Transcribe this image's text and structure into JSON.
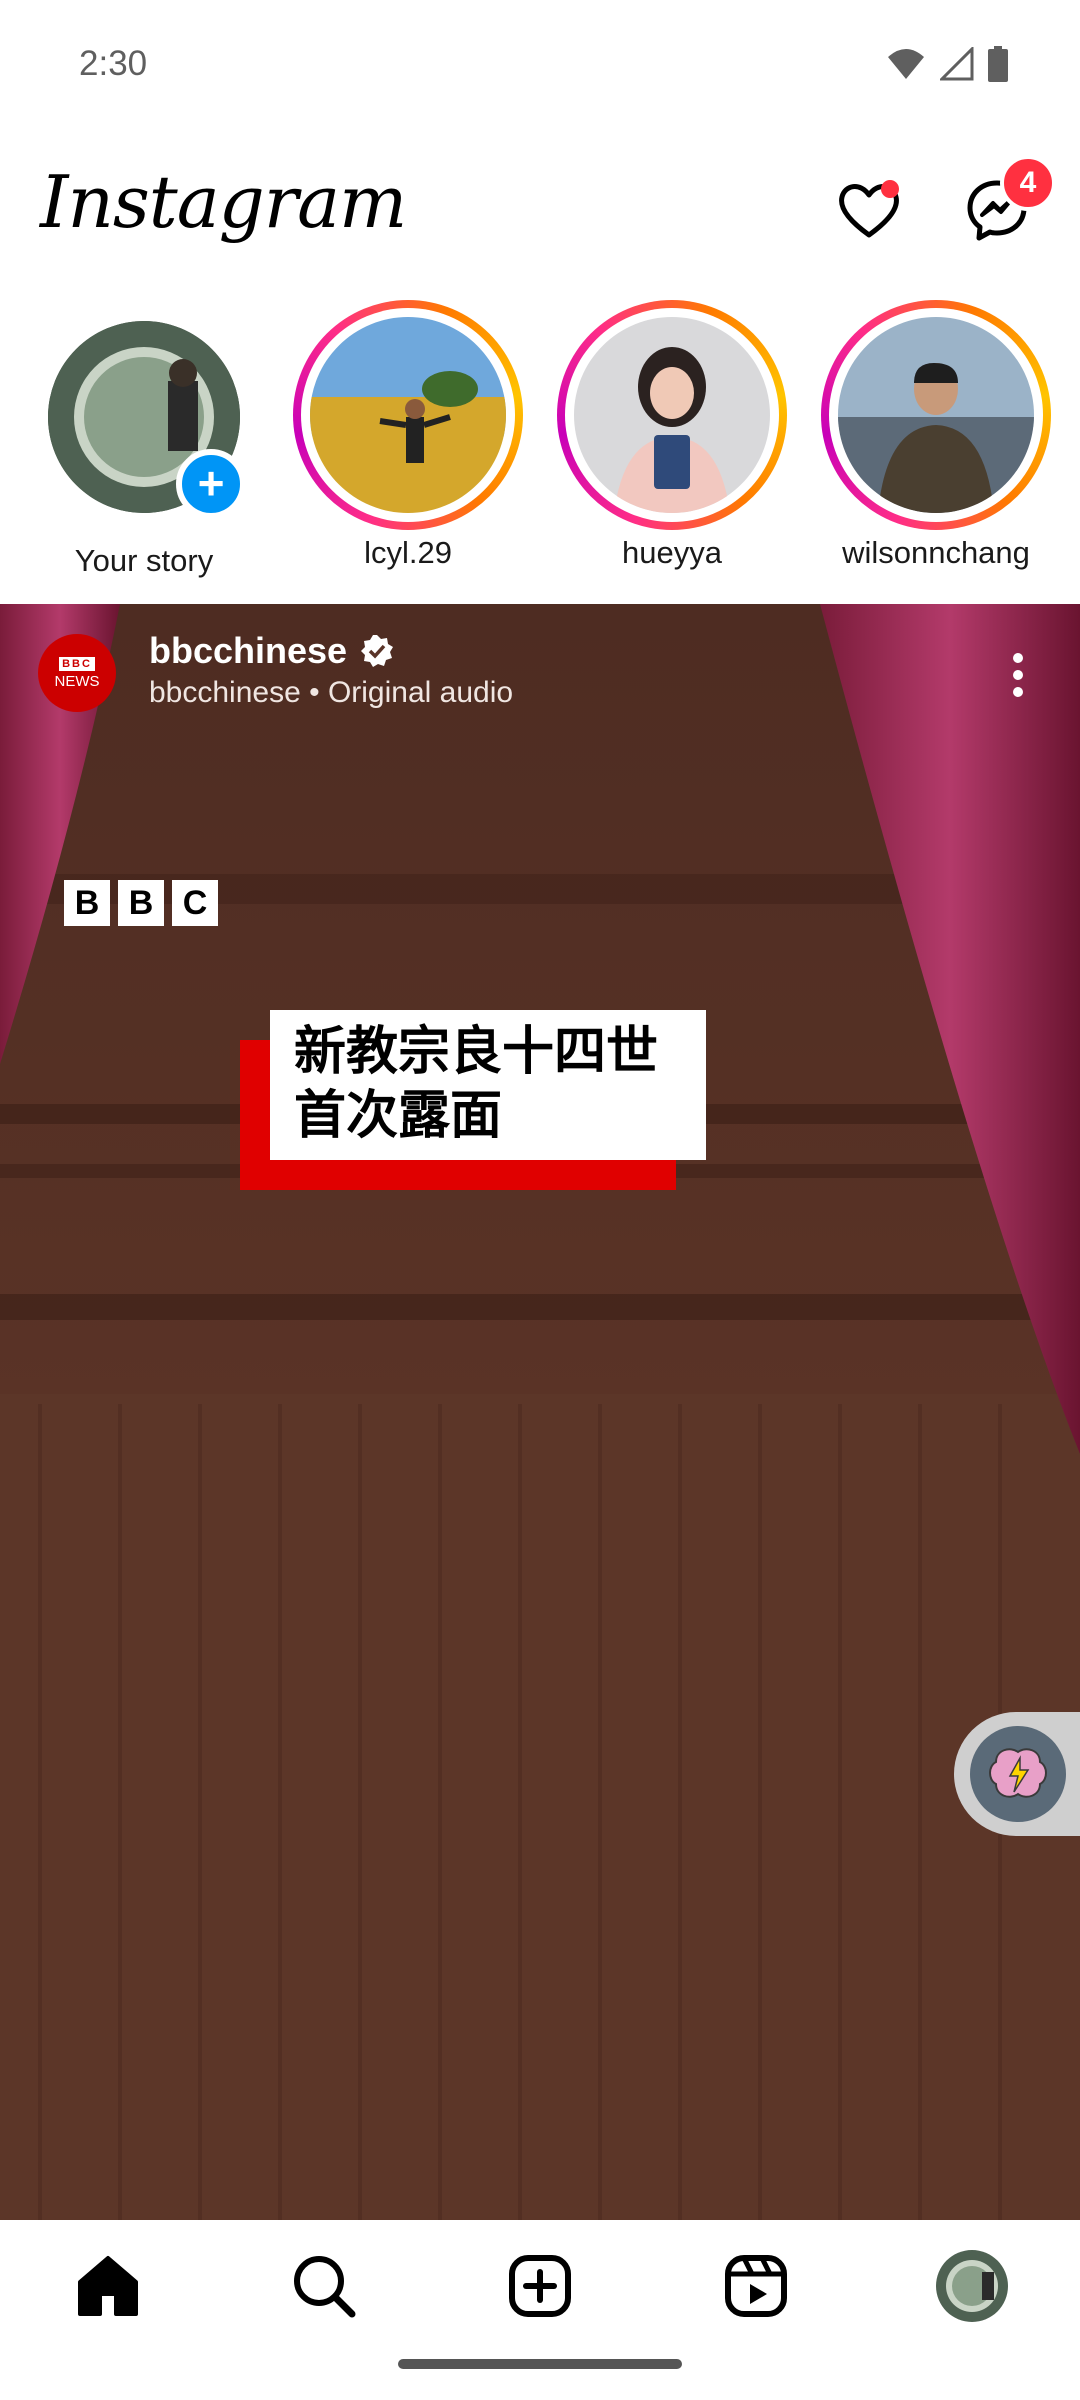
{
  "status_bar": {
    "time": "2:30"
  },
  "header": {
    "logo_text": "Instagram",
    "messages_badge": "4"
  },
  "stories": [
    {
      "name": "Your story",
      "is_own": true
    },
    {
      "name": "lcyl.29"
    },
    {
      "name": "hueyya"
    },
    {
      "name": "wilsonnchang"
    }
  ],
  "post": {
    "username": "bbcchinese",
    "subtitle": "bbcchinese • Original audio",
    "avatar_text_top": "BBC",
    "avatar_text_bottom": "NEWS",
    "bbc_letters": [
      "B",
      "B",
      "C"
    ],
    "headline_line1": "新教宗良十四世",
    "headline_line2": "首次露面"
  },
  "colors": {
    "accent_blue": "#0095f6",
    "notification_red": "#ff3040",
    "bbc_red": "#e00000"
  },
  "bottom_nav": {
    "items": [
      "home-icon",
      "search-icon",
      "create-icon",
      "reels-icon",
      "profile-avatar"
    ]
  }
}
